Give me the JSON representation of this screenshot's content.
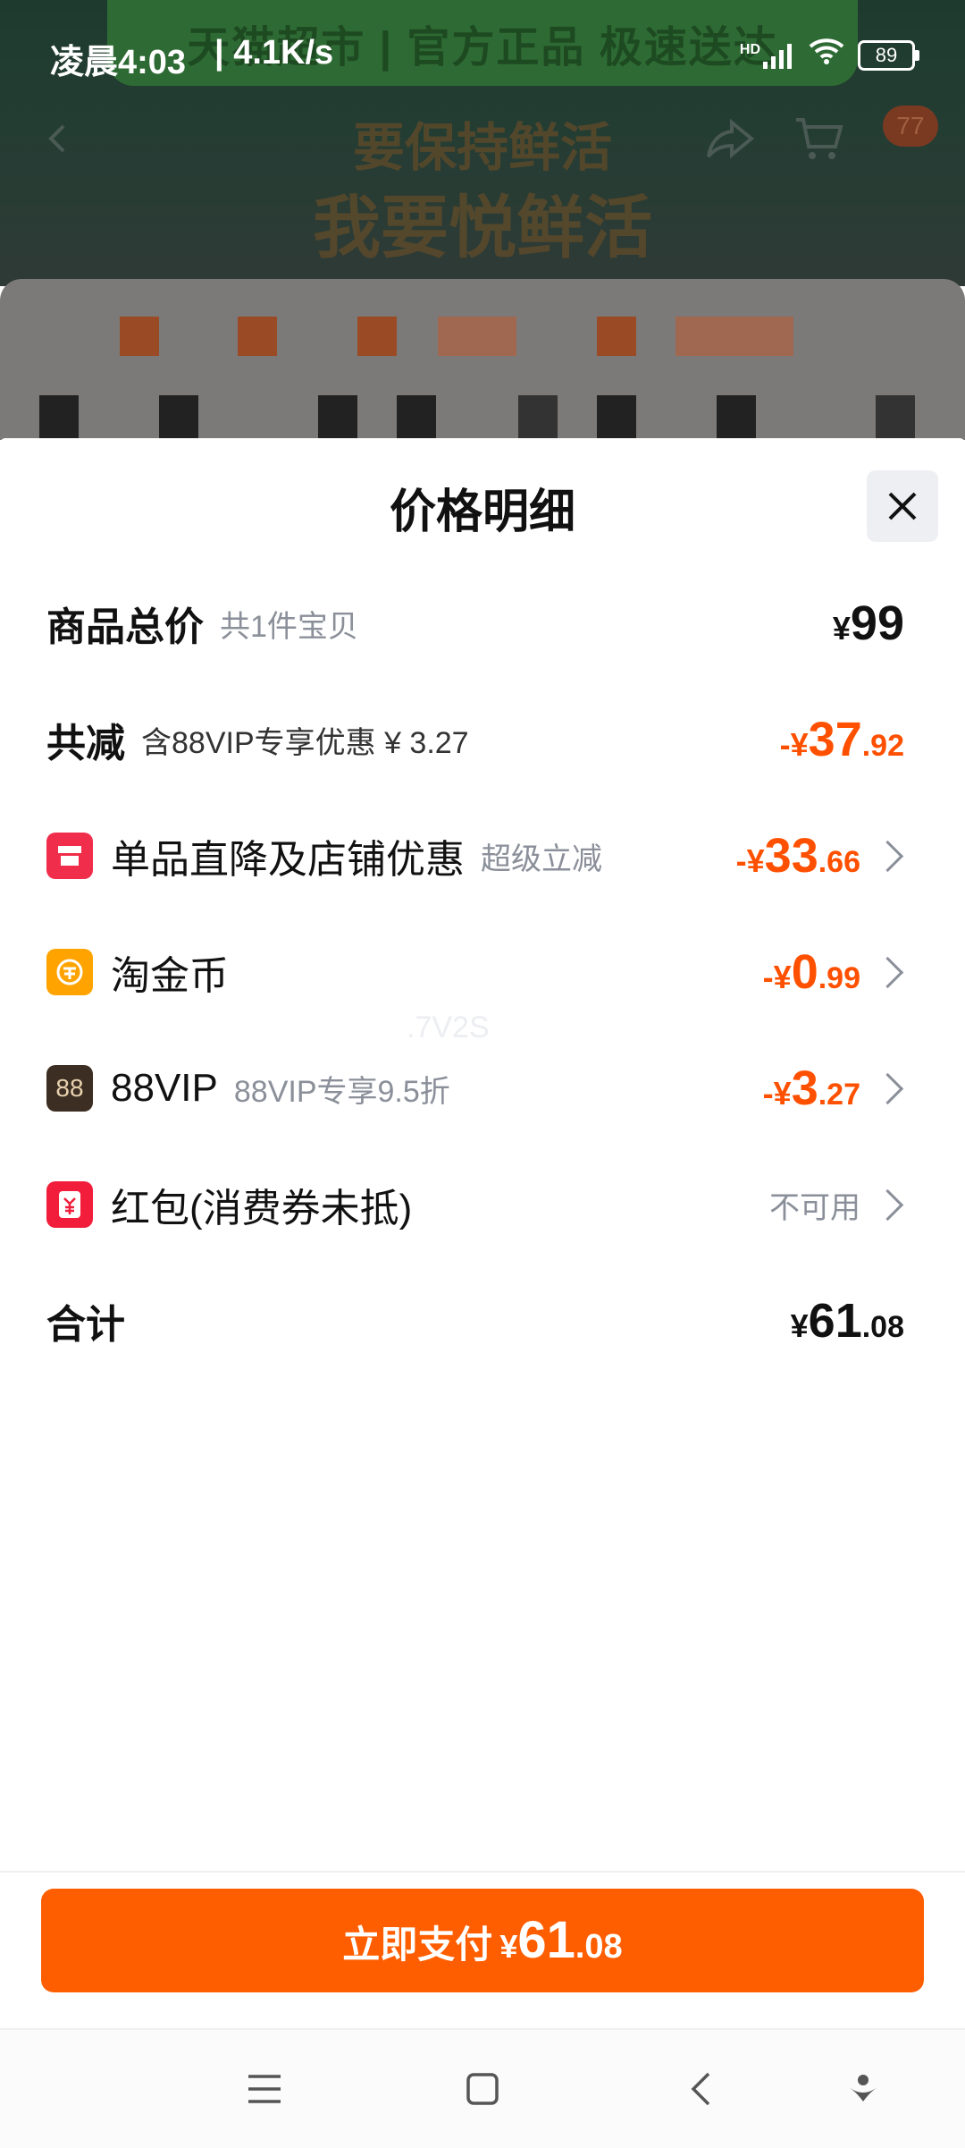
{
  "status_bar": {
    "time": "凌晨4:03",
    "network_speed": "| 4.1K/s",
    "battery": "89",
    "signal_label": "HD"
  },
  "background": {
    "banner_text": "天猫超市 | 官方正品 极速送达",
    "slogan_line1": "要保持鲜活",
    "slogan_line2": "我要悦鲜活",
    "cart_badge": "77"
  },
  "sheet": {
    "title": "价格明细",
    "rows": [
      {
        "label": "商品总价",
        "sub": "共1件宝贝",
        "amount": {
          "sign": "¥",
          "int": "99",
          "dec": ""
        }
      },
      {
        "label": "共减",
        "sub": "含88VIP专享优惠 ¥ 3.27",
        "amount": {
          "sign": "-¥",
          "int": "37",
          "dec": ".92"
        }
      },
      {
        "label": "单品直降及店铺优惠",
        "sub": "超级立减",
        "amount": {
          "sign": "-¥",
          "int": "33",
          "dec": ".66"
        }
      },
      {
        "label": "淘金币",
        "sub": "",
        "amount": {
          "sign": "-¥",
          "int": "0",
          "dec": ".99"
        }
      },
      {
        "label": "88VIP",
        "sub": "88VIP专享9.5折",
        "amount": {
          "sign": "-¥",
          "int": "3",
          "dec": ".27"
        }
      },
      {
        "label": "红包(消费券未抵)",
        "sub": "",
        "status": "不可用"
      },
      {
        "label": "合计",
        "sub": "",
        "amount": {
          "sign": "¥",
          "int": "61",
          "dec": ".08"
        }
      }
    ],
    "vip_icon_text": "88",
    "watermark": ".7V2S"
  },
  "pay_button": {
    "label": "立即支付",
    "sign": "¥",
    "int": "61",
    "dec": ".08"
  },
  "colors": {
    "accent": "#ff5000",
    "pay_button": "#ff5e00",
    "store_icon": "#f02d4a",
    "coin_icon": "#ffa300",
    "vip_icon": "#3c2e22",
    "hongbao_icon": "#f21d3b"
  }
}
